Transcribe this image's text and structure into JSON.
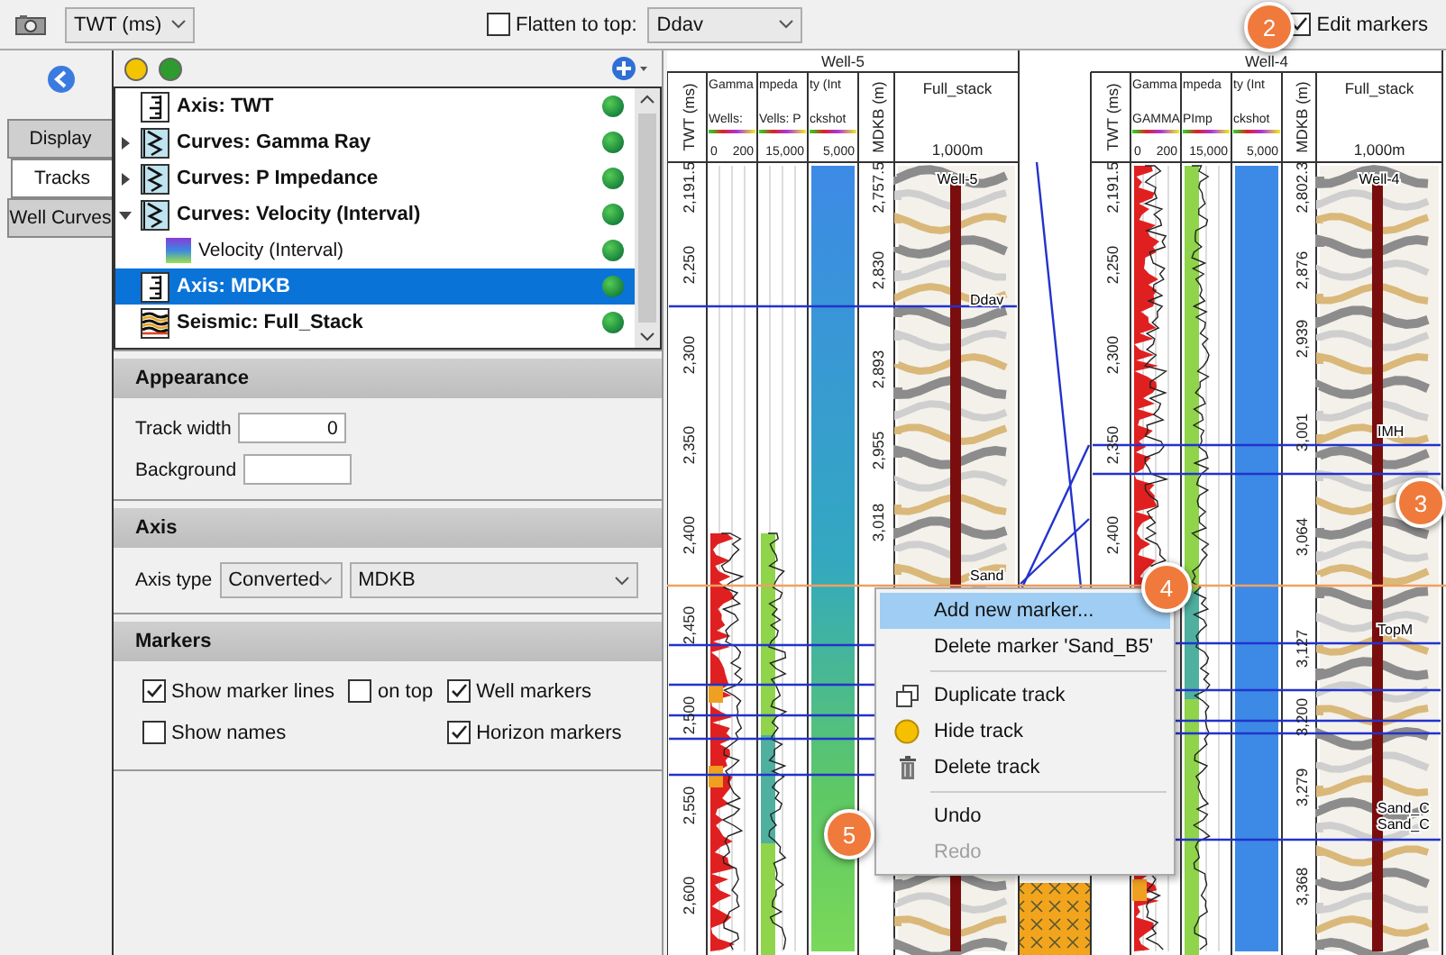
{
  "toolbar": {
    "time_dropdown": "TWT (ms)",
    "flatten": {
      "label": "Flatten to top:",
      "checked": false
    },
    "flatten_dropdown": "Ddav",
    "edit_markers": {
      "label": "Edit markers",
      "checked": true
    }
  },
  "side_tabs": [
    {
      "label": "Display",
      "selected": false
    },
    {
      "label": "Tracks",
      "selected": true
    },
    {
      "label": "Well Curves",
      "selected": false
    }
  ],
  "tracks_tree": [
    {
      "kind": "axis",
      "label": "Axis: TWT",
      "selected": false,
      "visible": true
    },
    {
      "kind": "curves",
      "label": "Curves: Gamma Ray",
      "selected": false,
      "visible": true,
      "expanded": false
    },
    {
      "kind": "curves",
      "label": "Curves: P Impedance",
      "selected": false,
      "visible": true,
      "expanded": false
    },
    {
      "kind": "curves",
      "label": "Curves: Velocity (Interval)",
      "selected": false,
      "visible": true,
      "expanded": true,
      "children": [
        {
          "kind": "curve",
          "label": "Velocity (Interval)",
          "selected": false,
          "visible": true
        }
      ]
    },
    {
      "kind": "axis",
      "label": "Axis: MDKB",
      "selected": true,
      "visible": true
    },
    {
      "kind": "seismic",
      "label": "Seismic: Full_Stack",
      "selected": false,
      "visible": true
    }
  ],
  "appearance": {
    "title": "Appearance",
    "track_width": {
      "label": "Track width",
      "value": "0"
    },
    "background": {
      "label": "Background"
    }
  },
  "axis": {
    "title": "Axis",
    "label": "Axis type",
    "type_dropdown": "Converted",
    "axis_dropdown": "MDKB"
  },
  "markers": {
    "title": "Markers",
    "options": [
      {
        "label": "Show marker lines",
        "checked": true
      },
      {
        "label": "on top",
        "checked": false
      },
      {
        "label": "Well markers",
        "checked": true
      },
      {
        "label": "Show names",
        "checked": false
      },
      {
        "label": "Horizon markers",
        "checked": true
      }
    ]
  },
  "wells": [
    {
      "name": "Well-5",
      "twt_label": "TWT (ms)",
      "twt_ticks": [
        "2,191.5",
        "2,250",
        "2,300",
        "2,350",
        "2,400",
        "2,450",
        "2,500",
        "2,550",
        "2,600"
      ],
      "curves": [
        {
          "title": "Gamma",
          "subtitle": "Wells:",
          "scale": [
            "0",
            "200"
          ]
        },
        {
          "title": "mpeda",
          "subtitle": "Vells: P",
          "scale": [
            "15,000"
          ]
        },
        {
          "title": "ty (Int",
          "subtitle": "ckshot",
          "scale": [
            "5,000"
          ]
        }
      ],
      "md_label": "MDKB (m)",
      "md_ticks": [
        "2,757.5",
        "2,830",
        "2,893",
        "2,955",
        "3,018"
      ],
      "seismic_title": "Full_stack",
      "seismic_scale": "1,000m",
      "seismic_labels": [
        "Well-5",
        "Ddav",
        "Sand"
      ]
    },
    {
      "name": "Well-4",
      "twt_label": "TWT (ms)",
      "twt_ticks": [
        "2,191.5",
        "2,250",
        "2,300",
        "2,350",
        "2,400"
      ],
      "curves": [
        {
          "title": "Gamma",
          "subtitle": "GAMMA",
          "scale": [
            "0",
            "200"
          ]
        },
        {
          "title": "mpeda",
          "subtitle": "PImp",
          "scale": [
            "15,000"
          ]
        },
        {
          "title": "ty (Int",
          "subtitle": "ckshot",
          "scale": [
            "5,000"
          ]
        }
      ],
      "md_label": "MDKB (m)",
      "md_ticks": [
        "2,802.3",
        "2,876",
        "2,939",
        "3,001",
        "3,064",
        "3,127",
        "3,200",
        "3,279",
        "3,368"
      ],
      "seismic_title": "Full_stack",
      "seismic_scale": "1,000m",
      "seismic_labels": [
        "Well-4",
        "IMH",
        "TopM",
        "Sand_C",
        "Sand_C"
      ]
    }
  ],
  "context_menu": [
    {
      "kind": "plain",
      "label": "Add new marker...",
      "selected": true,
      "disabled": false
    },
    {
      "kind": "plain",
      "label": "Delete marker  'Sand_B5'",
      "selected": false,
      "disabled": false
    },
    {
      "kind": "separator"
    },
    {
      "kind": "duplicate",
      "label": "Duplicate track",
      "selected": false,
      "disabled": false
    },
    {
      "kind": "hide",
      "label": "Hide track",
      "selected": false,
      "disabled": false
    },
    {
      "kind": "delete",
      "label": "Delete track",
      "selected": false,
      "disabled": false
    },
    {
      "kind": "separator"
    },
    {
      "kind": "plain",
      "label": "Undo",
      "selected": false,
      "disabled": false
    },
    {
      "kind": "plain",
      "label": "Redo",
      "selected": false,
      "disabled": true
    }
  ],
  "callouts": [
    "2",
    "3",
    "4",
    "5"
  ]
}
